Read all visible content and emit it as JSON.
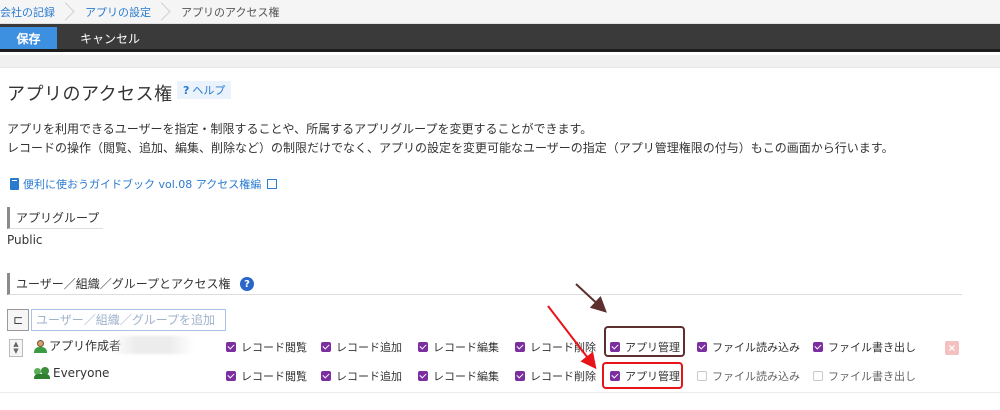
{
  "breadcrumb": {
    "items": [
      {
        "label": "会社の記録"
      },
      {
        "label": "アプリの設定"
      }
    ],
    "current": "アプリのアクセス権"
  },
  "toolbar": {
    "save_label": "保存",
    "cancel_label": "キャンセル"
  },
  "page": {
    "title": "アプリのアクセス権",
    "help_label": "ヘルプ",
    "help_mark": "?",
    "description_line1": "アプリを利用できるユーザーを指定・制限することや、所属するアプリグループを変更することができます。",
    "description_line2": "レコードの操作（閲覧、追加、編集、削除など）の制限だけでなく、アプリの設定を変更可能なユーザーの指定（アプリ管理権限の付与）もこの画面から行います。",
    "guide_link": "便利に使おうガイドブック vol.08 アクセス権編"
  },
  "app_group": {
    "heading": "アプリグループ",
    "value": "Public"
  },
  "access": {
    "heading": "ユーザー／組織／グループとアクセス権",
    "info_mark": "?",
    "add_placeholder": "ユーザー／組織／グループを追加",
    "rows": [
      {
        "entity": "アプリ作成者",
        "perms": [
          {
            "label": "レコード閲覧",
            "checked": true
          },
          {
            "label": "レコード追加",
            "checked": true
          },
          {
            "label": "レコード編集",
            "checked": true
          },
          {
            "label": "レコード削除",
            "checked": true
          },
          {
            "label": "アプリ管理",
            "checked": true
          },
          {
            "label": "ファイル読み込み",
            "checked": true
          },
          {
            "label": "ファイル書き出し",
            "checked": true
          }
        ]
      },
      {
        "entity": "Everyone",
        "perms": [
          {
            "label": "レコード閲覧",
            "checked": true
          },
          {
            "label": "レコード追加",
            "checked": true
          },
          {
            "label": "レコード編集",
            "checked": true
          },
          {
            "label": "レコード削除",
            "checked": true
          },
          {
            "label": "アプリ管理",
            "checked": true
          },
          {
            "label": "ファイル読み込み",
            "checked": false
          },
          {
            "label": "ファイル書き出し",
            "checked": false
          }
        ]
      }
    ]
  },
  "colors": {
    "checkbox_on": "#7b2ea0",
    "link": "#2a7bd0",
    "save_button": "#3d8fe0",
    "highlight_brown": "#5d2f2f",
    "highlight_red": "#e8141a"
  }
}
